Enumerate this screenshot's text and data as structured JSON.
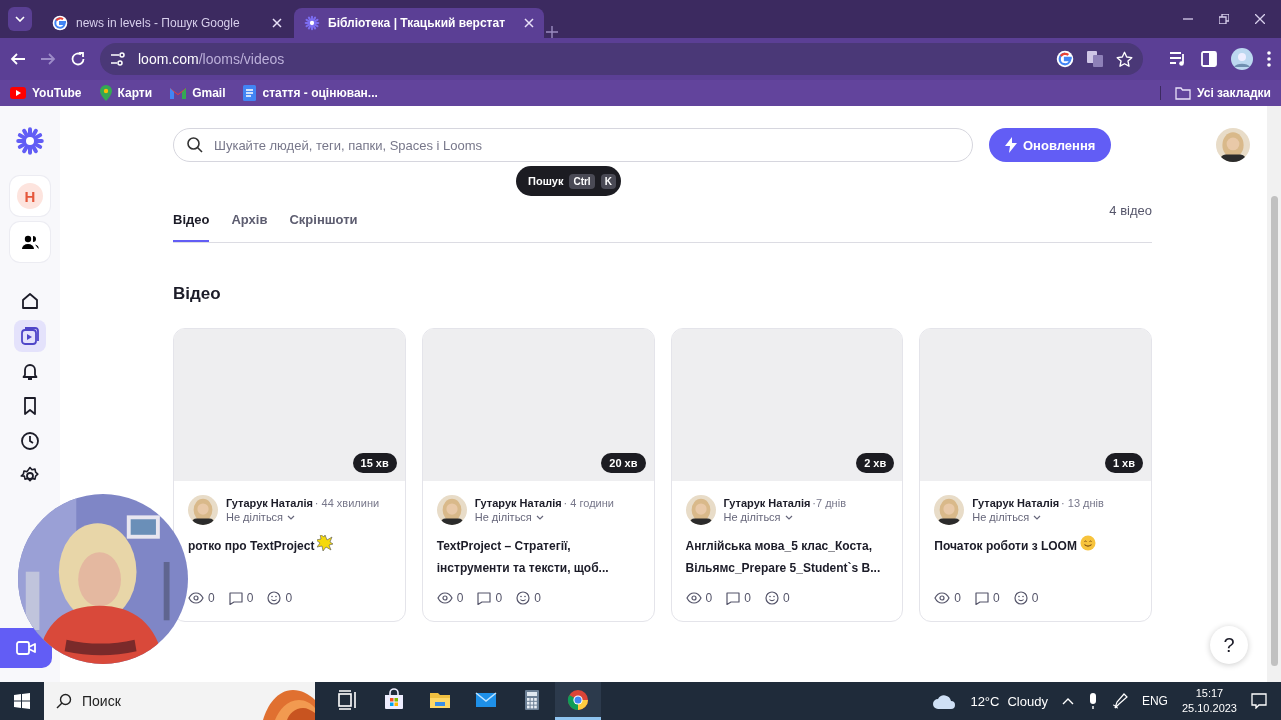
{
  "browser": {
    "tabs": [
      {
        "title": "news in levels - Пошук Google",
        "selected": false,
        "kind": "google"
      },
      {
        "title": "Бібліотека | Ткацький верстат",
        "selected": true,
        "kind": "loom"
      }
    ],
    "url_host": "loom.com",
    "url_path": "/looms/videos",
    "bookmarks": [
      {
        "label": "YouTube",
        "kind": "youtube"
      },
      {
        "label": "Карти",
        "kind": "maps"
      },
      {
        "label": "Gmail",
        "kind": "gmail"
      },
      {
        "label": "стаття - оцінюван...",
        "kind": "docs"
      }
    ],
    "all_bookmarks": "Усі закладки"
  },
  "sidebar": {
    "workspace": "H",
    "nav": [
      {
        "kind": "home",
        "selected": false
      },
      {
        "kind": "library",
        "selected": true
      },
      {
        "kind": "notifications",
        "selected": false
      },
      {
        "kind": "saved",
        "selected": false
      },
      {
        "kind": "history",
        "selected": false
      },
      {
        "kind": "settings",
        "selected": false
      }
    ]
  },
  "search": {
    "placeholder": "Шукайте людей, теги, папки, Spaces і Looms"
  },
  "upgrade_button": "Оновлення",
  "tooltip": {
    "label": "Пошук",
    "keys": [
      "Ctrl",
      "K"
    ]
  },
  "tabs": [
    {
      "label": "Відео",
      "selected": true
    },
    {
      "label": "Архів",
      "selected": false
    },
    {
      "label": "Скріншоти",
      "selected": false
    }
  ],
  "count": "4 відео",
  "section_title": "Відео",
  "cards": [
    {
      "duration": "15 хв",
      "author": "Гутарук Наталія",
      "time": "· 44 хвилини",
      "sharing": "Не діліться",
      "title": "ротко про TextProject",
      "kind": "burst",
      "views": "0",
      "comments": "0",
      "reactions": "0"
    },
    {
      "duration": "20 хв",
      "author": "Гутарук Наталія",
      "time": "· 4 години",
      "sharing": "Не діліться",
      "title": "TextProject – Стратегії, інструменти та тексти, щоб...",
      "kind": "plain",
      "views": "0",
      "comments": "0",
      "reactions": "0"
    },
    {
      "duration": "2 хв",
      "author": "Гутарук Наталія",
      "time": "·7 днів",
      "sharing": "Не діліться",
      "title": "Англійська мова_5 клас_Коста, Вільямс_Prepare 5_Student`s B...",
      "kind": "plain",
      "views": "0",
      "comments": "0",
      "reactions": "0"
    },
    {
      "duration": "1 хв",
      "author": "Гутарук Наталія",
      "time": "· 13 днів",
      "sharing": "Не діліться",
      "title": "Початок роботи з LOOM",
      "kind": "smile",
      "views": "0",
      "comments": "0",
      "reactions": "0"
    }
  ],
  "help": "?",
  "taskbar": {
    "search": "Поиск",
    "apps": [
      {
        "kind": "taskview",
        "active": false
      },
      {
        "kind": "store",
        "active": false
      },
      {
        "kind": "files",
        "active": false
      },
      {
        "kind": "mail",
        "active": false
      },
      {
        "kind": "calculator",
        "active": false
      },
      {
        "kind": "chrome",
        "active": true
      }
    ],
    "temperature": "12°C",
    "weather": "Cloudy",
    "language": "ENG",
    "time": "15:17",
    "date": "25.10.2023"
  }
}
